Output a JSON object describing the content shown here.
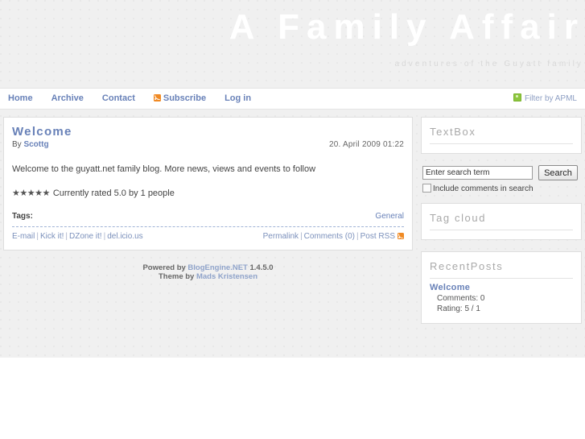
{
  "header": {
    "title": "A Family Affair",
    "subtitle": "adventures of the Guyatt family"
  },
  "nav": {
    "items": [
      {
        "label": "Home",
        "icon": null
      },
      {
        "label": "Archive",
        "icon": null
      },
      {
        "label": "Contact",
        "icon": null
      },
      {
        "label": "Subscribe",
        "icon": "rss-icon"
      },
      {
        "label": "Log in",
        "icon": null
      }
    ],
    "apml": {
      "label": "Filter by APML",
      "icon": "apml-icon"
    }
  },
  "post": {
    "title": "Welcome",
    "author_label": "By",
    "author": "Scottg",
    "date": "20. April 2009 01:22",
    "body": "Welcome to the guyatt.net family blog.  More news, views and events to follow",
    "stars": "★★★★★",
    "rating_text": "Currently rated 5.0 by 1 people",
    "tags_label": "Tags:",
    "tags": "General",
    "footer_left": [
      {
        "label": "E-mail"
      },
      {
        "label": "Kick it!"
      },
      {
        "label": "DZone it!"
      },
      {
        "label": "del.icio.us"
      }
    ],
    "footer_right": [
      {
        "label": "Permalink"
      },
      {
        "label": "Comments (0)"
      },
      {
        "label": "Post RSS"
      }
    ],
    "separator": "|"
  },
  "credits": {
    "powered_by_label": "Powered by",
    "engine_name": "BlogEngine.NET",
    "version": "1.4.5.0",
    "theme_by_label": "Theme by",
    "theme_author": "Mads Kristensen"
  },
  "sidebar": {
    "textbox": {
      "title": "TextBox"
    },
    "search": {
      "placeholder": "Enter search term",
      "value": "Enter search term",
      "button_label": "Search",
      "checkbox_label": "Include comments in search",
      "checked": false
    },
    "tagcloud": {
      "title": "Tag cloud"
    },
    "recentposts": {
      "title": "RecentPosts",
      "items": [
        {
          "title": "Welcome",
          "comments": "Comments: 0",
          "rating": "Rating: 5 / 1"
        }
      ]
    }
  },
  "colors": {
    "page_bg": "#f0f0f0",
    "link": "#6881b8",
    "widget_title": "#a9a9a9",
    "rss_orange": "#f08a24",
    "apml_green": "#8dc63f",
    "border": "#dedede"
  }
}
